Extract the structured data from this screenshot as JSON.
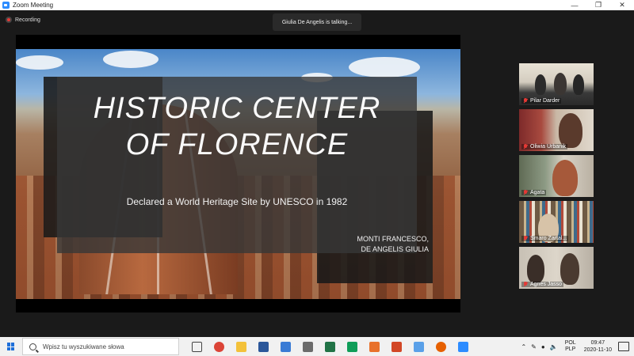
{
  "window": {
    "title": "Zoom Meeting"
  },
  "meeting": {
    "recording_label": "Recording",
    "talking_indicator": "Giulia De Angelis is talking..."
  },
  "slide": {
    "title_line1": "HISTORIC CENTER",
    "title_line2": "OF FLORENCE",
    "subtitle": "Declared a World Heritage Site by UNESCO in 1982",
    "author1": "MONTI FRANCESCO,",
    "author2": "DE ANGELIS GIULIA"
  },
  "participants": [
    {
      "name": "Pilar Darder",
      "muted": true
    },
    {
      "name": "Oliwia Urbanik",
      "muted": true
    },
    {
      "name": "Agata",
      "muted": true
    },
    {
      "name": "Smaro Zartal...",
      "muted": true
    },
    {
      "name": "Agnes Jasso",
      "muted": true
    }
  ],
  "taskbar": {
    "search_placeholder": "Wpisz tu wyszukiwane słowa",
    "apps": [
      {
        "icon": "task-view-icon",
        "color": "#444444"
      },
      {
        "icon": "chrome-icon",
        "color": "#db4437"
      },
      {
        "icon": "file-explorer-icon",
        "color": "#f3c13a"
      },
      {
        "icon": "word-icon",
        "color": "#2b579a"
      },
      {
        "icon": "notepad-icon",
        "color": "#3a7bd5"
      },
      {
        "icon": "calculator-icon",
        "color": "#6b6b6b"
      },
      {
        "icon": "excel-icon",
        "color": "#217346"
      },
      {
        "icon": "sheets-icon",
        "color": "#0f9d58"
      },
      {
        "icon": "media-player-icon",
        "color": "#e8712b"
      },
      {
        "icon": "powerpoint-icon",
        "color": "#d24726"
      },
      {
        "icon": "photos-icon",
        "color": "#5aa0e8"
      },
      {
        "icon": "firefox-icon",
        "color": "#e66000"
      },
      {
        "icon": "zoom-icon",
        "color": "#2d8cff"
      }
    ],
    "lang_top": "POL",
    "lang_bottom": "PLP",
    "time": "09:47",
    "date": "2020-11-10"
  },
  "colors": {
    "accent": "#2d8cff",
    "muted": "#e53935"
  }
}
